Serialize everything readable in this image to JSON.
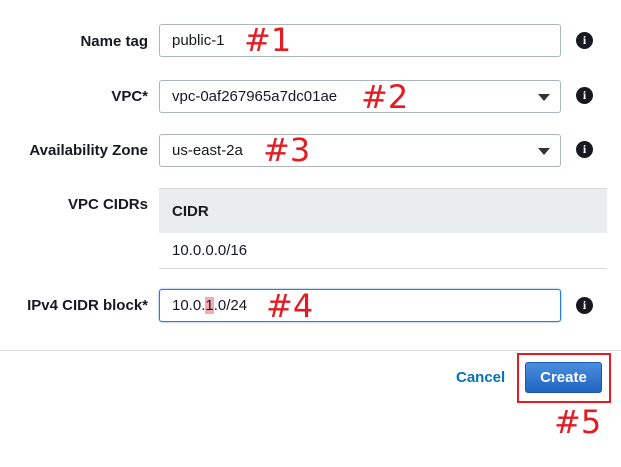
{
  "form": {
    "name_tag": {
      "label": "Name tag",
      "value": "public-1"
    },
    "vpc": {
      "label": "VPC*",
      "value": "vpc-0af267965a7dc01ae"
    },
    "availability_zone": {
      "label": "Availability Zone",
      "value": "us-east-2a"
    },
    "vpc_cidrs": {
      "label": "VPC CIDRs",
      "column_header": "CIDR",
      "rows": [
        "10.0.0.0/16"
      ]
    },
    "ipv4_cidr_block": {
      "label": "IPv4 CIDR block*",
      "value_prefix": "10.0.",
      "value_highlight": "1",
      "value_suffix": ".0/24"
    }
  },
  "info_icon_glyph": "i",
  "actions": {
    "cancel_label": "Cancel",
    "create_label": "Create"
  },
  "annotations": [
    "#1",
    "#2",
    "#3",
    "#4",
    "#5"
  ],
  "colors": {
    "annotation": "#e31b23",
    "primary_button": "#1f64c0",
    "link": "#0073bb",
    "focus_border": "#2e7dd2"
  }
}
